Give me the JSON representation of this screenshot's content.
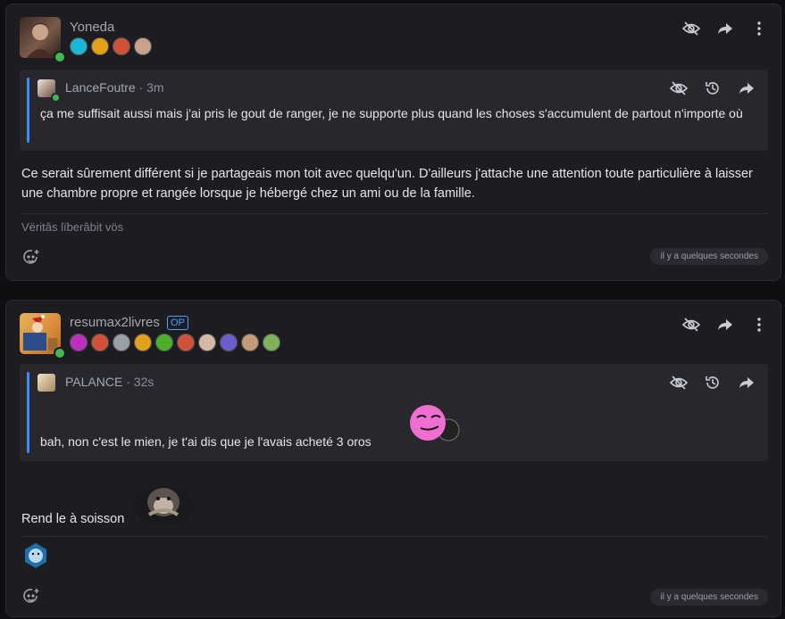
{
  "posts": [
    {
      "username": "Yoneda",
      "quote": {
        "author": "LanceFoutre",
        "time": "3m",
        "text": "ça me suffisait aussi mais j'ai pris le gout de ranger, je ne supporte plus quand les choses s'accumulent de partout n'importe où"
      },
      "body": "Ce serait sûrement différent si je partageais mon toit avec quelqu'un. D'ailleurs j'attache une attention toute particulière à laisser une chambre propre et rangée lorsque je hébergé chez un ami ou de la famille.",
      "signature": "Vëritâs lïberâbit vös",
      "timestamp": "il y a quelques secondes",
      "badge_colors": [
        "#18b7d6",
        "#e2a11b",
        "#d0503a",
        "#c8a38a"
      ]
    },
    {
      "username": "resumax2livres",
      "op_label": "OP",
      "quote": {
        "author": "PALANCE",
        "time": "32s",
        "text": "bah, non c'est le mien, je t'ai dis que je l'avais acheté 3 oros"
      },
      "body": "Rend le à soisson",
      "timestamp": "il y a quelques secondes",
      "badge_colors": [
        "#c02cc0",
        "#d0503a",
        "#9aa0a8",
        "#e2a11b",
        "#4caf2a",
        "#d0503a",
        "#d8b9a8",
        "#6a5cc9",
        "#c49a7a",
        "#7fb25a"
      ]
    }
  ],
  "icons": {
    "hide": "eye-slash-icon",
    "share": "share-arrow-icon",
    "more": "kebab-icon",
    "history": "history-icon",
    "react": "add-reaction-icon"
  },
  "colors": {
    "accent": "#3d8bfd",
    "online": "#3fb950"
  }
}
